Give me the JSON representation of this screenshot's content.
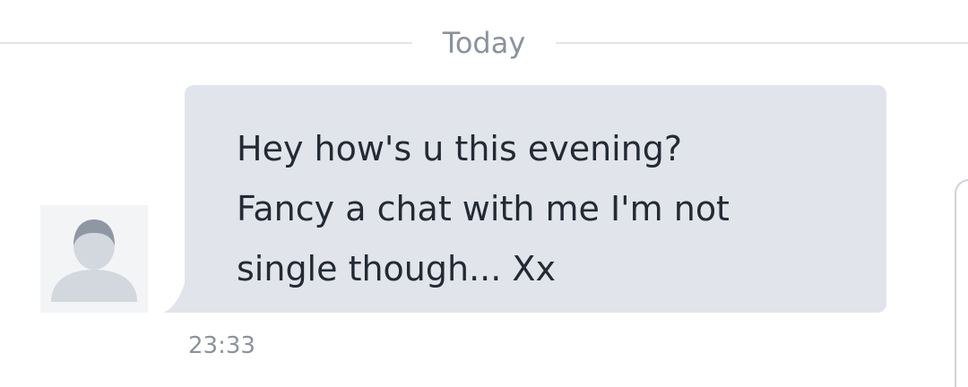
{
  "conversation": {
    "date_divider": "Today",
    "messages": [
      {
        "sender": "incoming",
        "avatar_icon": "default-user-avatar-icon",
        "text": "Hey how's u this evening?\nFancy a chat with me I'm not\nsingle though... Xx",
        "time": "23:33"
      }
    ]
  },
  "colors": {
    "bubble_background": "#e1e4ea",
    "message_text": "#232a35",
    "muted_text": "#8a929e",
    "divider": "#e1e4ea",
    "avatar_background": "#f3f4f6",
    "avatar_silhouette": "#d3d7de",
    "avatar_head": "#8f97a3"
  }
}
